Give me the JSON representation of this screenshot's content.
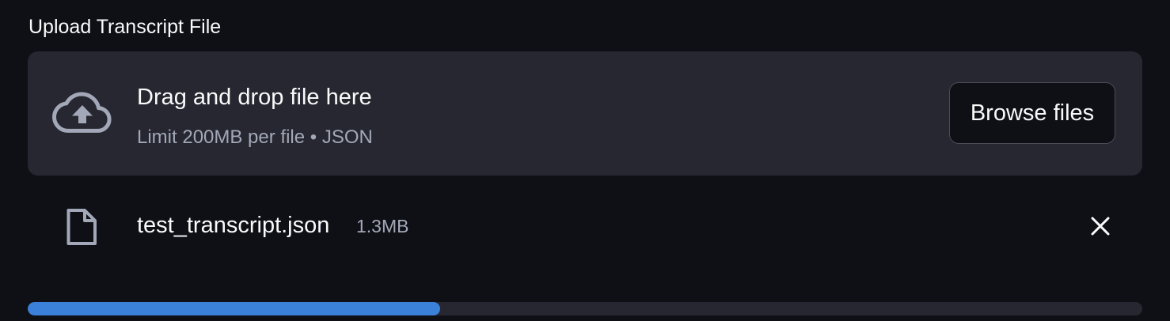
{
  "uploader": {
    "label": "Upload Transcript File",
    "dropzone": {
      "icon": "cloud-upload-icon",
      "title": "Drag and drop file here",
      "subtitle": "Limit 200MB per file • JSON"
    },
    "browse_button_label": "Browse files",
    "file": {
      "icon": "file-icon",
      "name": "test_transcript.json",
      "size": "1.3MB",
      "remove_icon": "close-icon"
    },
    "progress": {
      "fraction": 0.37
    },
    "colors": {
      "background": "#0f1016",
      "panel": "#262730",
      "progress_fill": "#3b80d9",
      "muted_text": "#a3a8b8"
    }
  }
}
